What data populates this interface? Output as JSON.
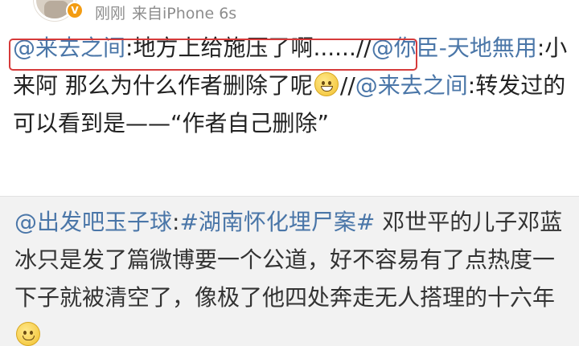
{
  "post": {
    "time": "刚刚",
    "source": "来自iPhone 6s",
    "verified_icon": "v-badge-icon",
    "colors": {
      "mention": "#4a76a8",
      "highlight_box": "#d63a3a",
      "quoted_bg": "#f2f2f2"
    }
  },
  "repost": {
    "m1": "@来去之间",
    "t1": ":地方上给施压了啊......",
    "sep1": "//",
    "m2": "@你臣-天地無用",
    "t2": ":小来阿 那么为什么作者删除了呢",
    "emoji1": "grinning-face-icon",
    "sep2": "//",
    "m3": "@来去之间",
    "t3": ":转发过的可以看到是——“作者自己删除”"
  },
  "quoted": {
    "m1": "@出发吧玉子球",
    "colon": ":",
    "hashtag": "#湖南怀化埋尸案#",
    "body": " 邓世平的儿子邓蓝冰只是发了篇微博要一个公道，好不容易有了点热度一下子就被清空了，像极了他四处奔走无人搭理的十六年",
    "emoji": "smiling-face-icon"
  }
}
